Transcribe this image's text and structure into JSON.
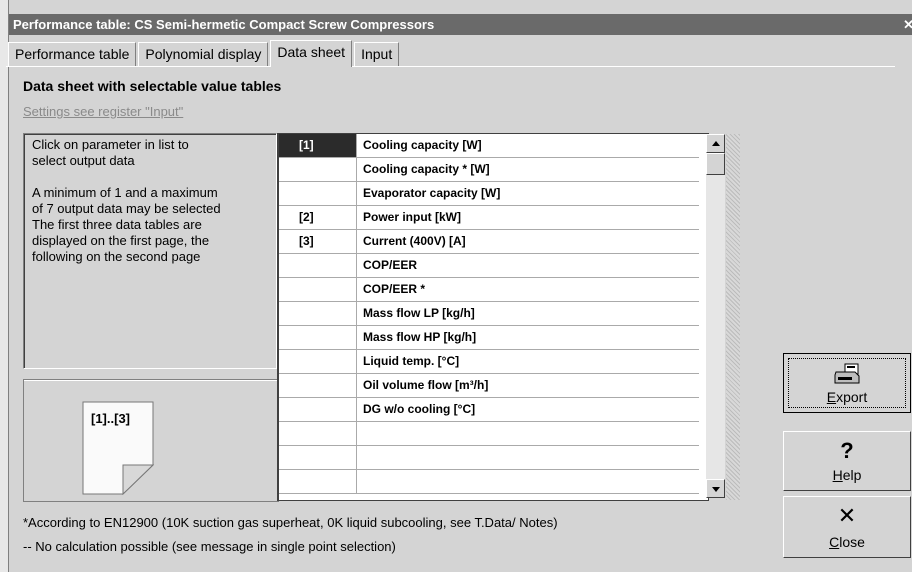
{
  "window": {
    "title": "Performance table: CS Semi-hermetic Compact Screw Compressors",
    "close_glyph": "✕"
  },
  "tabs": [
    {
      "label": "Performance table",
      "active": false
    },
    {
      "label": "Polynomial display",
      "active": false
    },
    {
      "label": "Data sheet",
      "active": true
    },
    {
      "label": "Input",
      "active": false
    }
  ],
  "panel": {
    "heading": "Data sheet with selectable value tables",
    "settings_link": "Settings see register \"Input\""
  },
  "info": {
    "line1": "Click on parameter in list to",
    "line2": "select output data",
    "line3": "A minimum of 1 and a maximum",
    "line4": "of 7 output data may be selected",
    "line5": "The first three data tables are",
    "line6": "displayed on the first page, the",
    "line7": "following on the second page"
  },
  "preview": {
    "label": "[1]..[3]"
  },
  "parameters": [
    {
      "index": "[1]",
      "name": "Cooling capacity [W]",
      "selected": true
    },
    {
      "index": "",
      "name": "Cooling capacity * [W]"
    },
    {
      "index": "",
      "name": "Evaporator capacity [W]"
    },
    {
      "index": "[2]",
      "name": "Power input [kW]"
    },
    {
      "index": "[3]",
      "name": "Current (400V) [A]"
    },
    {
      "index": "",
      "name": "COP/EER"
    },
    {
      "index": "",
      "name": "COP/EER *"
    },
    {
      "index": "",
      "name": "Mass flow LP [kg/h]"
    },
    {
      "index": "",
      "name": "Mass flow HP [kg/h]"
    },
    {
      "index": "",
      "name": "Liquid temp. [°C]"
    },
    {
      "index": "",
      "name": "Oil volume flow [m³/h]"
    },
    {
      "index": "",
      "name": "DG w/o cooling [°C]"
    },
    {
      "index": "",
      "name": ""
    },
    {
      "index": "",
      "name": ""
    },
    {
      "index": "",
      "name": ""
    }
  ],
  "buttons": {
    "export": {
      "mnemonic": "E",
      "rest": "xport",
      "icon": "printer-icon"
    },
    "help": {
      "mnemonic": "H",
      "rest": "elp",
      "icon_glyph": "?"
    },
    "close": {
      "mnemonic": "C",
      "rest": "lose",
      "icon_glyph": "✕"
    }
  },
  "footer": {
    "note": "*According to EN12900 (10K suction gas superheat, 0K liquid subcooling, see T.Data/ Notes)",
    "nocalc": "-- No calculation possible (see message in single point selection)"
  }
}
